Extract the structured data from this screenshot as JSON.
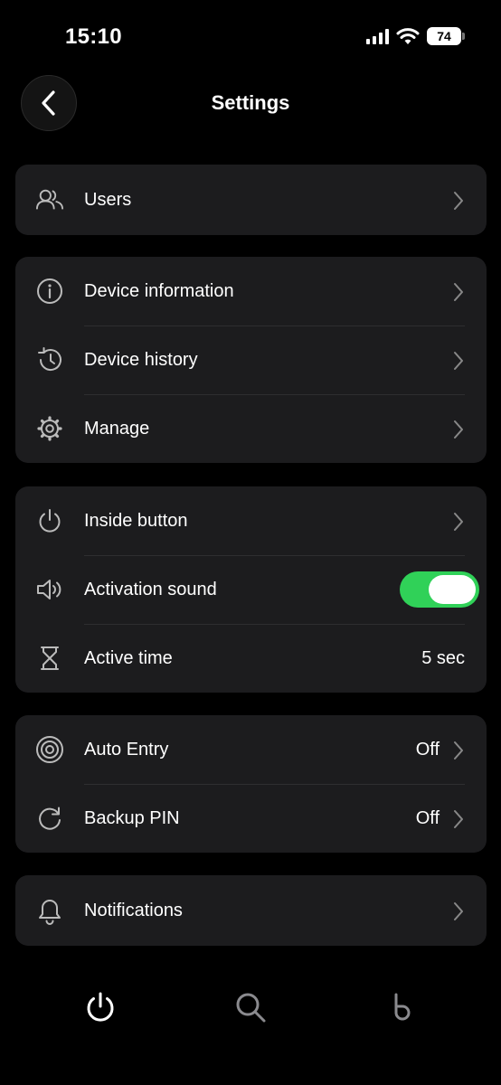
{
  "status_bar": {
    "time": "15:10",
    "battery": "74"
  },
  "header": {
    "title": "Settings"
  },
  "sections": {
    "users": {
      "label": "Users"
    },
    "device": {
      "info": "Device information",
      "history": "Device history",
      "manage": "Manage"
    },
    "button": {
      "inside": "Inside button",
      "sound": "Activation sound",
      "sound_enabled": true,
      "active_time": "Active time",
      "active_time_value": "5 sec"
    },
    "entry": {
      "auto": "Auto Entry",
      "auto_value": "Off",
      "pin": "Backup PIN",
      "pin_value": "Off"
    },
    "notifications": {
      "label": "Notifications"
    }
  },
  "tab_bar": [
    "power-icon",
    "search-icon",
    "brand-logo-icon"
  ],
  "colors": {
    "toggle_on": "#30d158",
    "card": "#1c1c1e",
    "background": "#000000"
  }
}
